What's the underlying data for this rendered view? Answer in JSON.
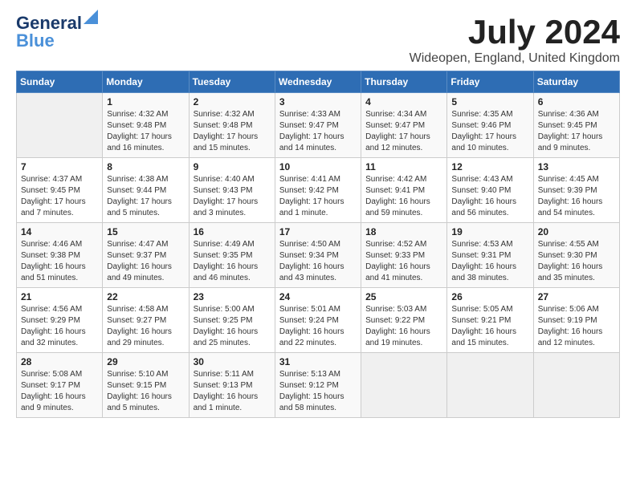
{
  "header": {
    "logo_line1": "General",
    "logo_line2": "Blue",
    "month_year": "July 2024",
    "location": "Wideopen, England, United Kingdom"
  },
  "days_of_week": [
    "Sunday",
    "Monday",
    "Tuesday",
    "Wednesday",
    "Thursday",
    "Friday",
    "Saturday"
  ],
  "weeks": [
    [
      {
        "day": "",
        "content": ""
      },
      {
        "day": "1",
        "content": "Sunrise: 4:32 AM\nSunset: 9:48 PM\nDaylight: 17 hours and 16 minutes."
      },
      {
        "day": "2",
        "content": "Sunrise: 4:32 AM\nSunset: 9:48 PM\nDaylight: 17 hours and 15 minutes."
      },
      {
        "day": "3",
        "content": "Sunrise: 4:33 AM\nSunset: 9:47 PM\nDaylight: 17 hours and 14 minutes."
      },
      {
        "day": "4",
        "content": "Sunrise: 4:34 AM\nSunset: 9:47 PM\nDaylight: 17 hours and 12 minutes."
      },
      {
        "day": "5",
        "content": "Sunrise: 4:35 AM\nSunset: 9:46 PM\nDaylight: 17 hours and 10 minutes."
      },
      {
        "day": "6",
        "content": "Sunrise: 4:36 AM\nSunset: 9:45 PM\nDaylight: 17 hours and 9 minutes."
      }
    ],
    [
      {
        "day": "7",
        "content": "Sunrise: 4:37 AM\nSunset: 9:45 PM\nDaylight: 17 hours and 7 minutes."
      },
      {
        "day": "8",
        "content": "Sunrise: 4:38 AM\nSunset: 9:44 PM\nDaylight: 17 hours and 5 minutes."
      },
      {
        "day": "9",
        "content": "Sunrise: 4:40 AM\nSunset: 9:43 PM\nDaylight: 17 hours and 3 minutes."
      },
      {
        "day": "10",
        "content": "Sunrise: 4:41 AM\nSunset: 9:42 PM\nDaylight: 17 hours and 1 minute."
      },
      {
        "day": "11",
        "content": "Sunrise: 4:42 AM\nSunset: 9:41 PM\nDaylight: 16 hours and 59 minutes."
      },
      {
        "day": "12",
        "content": "Sunrise: 4:43 AM\nSunset: 9:40 PM\nDaylight: 16 hours and 56 minutes."
      },
      {
        "day": "13",
        "content": "Sunrise: 4:45 AM\nSunset: 9:39 PM\nDaylight: 16 hours and 54 minutes."
      }
    ],
    [
      {
        "day": "14",
        "content": "Sunrise: 4:46 AM\nSunset: 9:38 PM\nDaylight: 16 hours and 51 minutes."
      },
      {
        "day": "15",
        "content": "Sunrise: 4:47 AM\nSunset: 9:37 PM\nDaylight: 16 hours and 49 minutes."
      },
      {
        "day": "16",
        "content": "Sunrise: 4:49 AM\nSunset: 9:35 PM\nDaylight: 16 hours and 46 minutes."
      },
      {
        "day": "17",
        "content": "Sunrise: 4:50 AM\nSunset: 9:34 PM\nDaylight: 16 hours and 43 minutes."
      },
      {
        "day": "18",
        "content": "Sunrise: 4:52 AM\nSunset: 9:33 PM\nDaylight: 16 hours and 41 minutes."
      },
      {
        "day": "19",
        "content": "Sunrise: 4:53 AM\nSunset: 9:31 PM\nDaylight: 16 hours and 38 minutes."
      },
      {
        "day": "20",
        "content": "Sunrise: 4:55 AM\nSunset: 9:30 PM\nDaylight: 16 hours and 35 minutes."
      }
    ],
    [
      {
        "day": "21",
        "content": "Sunrise: 4:56 AM\nSunset: 9:29 PM\nDaylight: 16 hours and 32 minutes."
      },
      {
        "day": "22",
        "content": "Sunrise: 4:58 AM\nSunset: 9:27 PM\nDaylight: 16 hours and 29 minutes."
      },
      {
        "day": "23",
        "content": "Sunrise: 5:00 AM\nSunset: 9:25 PM\nDaylight: 16 hours and 25 minutes."
      },
      {
        "day": "24",
        "content": "Sunrise: 5:01 AM\nSunset: 9:24 PM\nDaylight: 16 hours and 22 minutes."
      },
      {
        "day": "25",
        "content": "Sunrise: 5:03 AM\nSunset: 9:22 PM\nDaylight: 16 hours and 19 minutes."
      },
      {
        "day": "26",
        "content": "Sunrise: 5:05 AM\nSunset: 9:21 PM\nDaylight: 16 hours and 15 minutes."
      },
      {
        "day": "27",
        "content": "Sunrise: 5:06 AM\nSunset: 9:19 PM\nDaylight: 16 hours and 12 minutes."
      }
    ],
    [
      {
        "day": "28",
        "content": "Sunrise: 5:08 AM\nSunset: 9:17 PM\nDaylight: 16 hours and 9 minutes."
      },
      {
        "day": "29",
        "content": "Sunrise: 5:10 AM\nSunset: 9:15 PM\nDaylight: 16 hours and 5 minutes."
      },
      {
        "day": "30",
        "content": "Sunrise: 5:11 AM\nSunset: 9:13 PM\nDaylight: 16 hours and 1 minute."
      },
      {
        "day": "31",
        "content": "Sunrise: 5:13 AM\nSunset: 9:12 PM\nDaylight: 15 hours and 58 minutes."
      },
      {
        "day": "",
        "content": ""
      },
      {
        "day": "",
        "content": ""
      },
      {
        "day": "",
        "content": ""
      }
    ]
  ]
}
